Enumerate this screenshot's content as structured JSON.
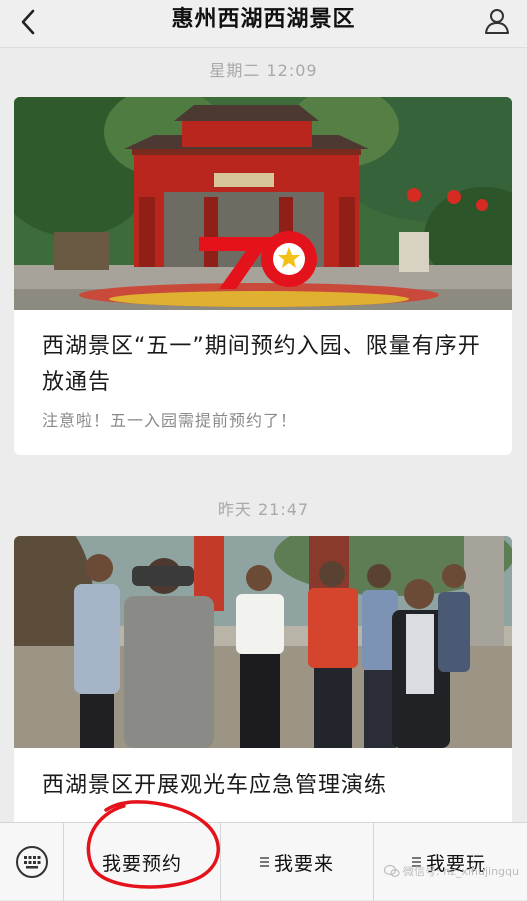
{
  "header": {
    "title": "惠州西湖西湖景区"
  },
  "feed": [
    {
      "time": "星期二 12:09",
      "title": "西湖景区“五一”期间预约入园、限量有序开放通告",
      "digest": "注意啦！五一入园需提前预约了！"
    },
    {
      "time": "昨天 21:47",
      "title": "西湖景区开展观光车应急管理演练"
    }
  ],
  "menu": {
    "items": [
      "我要预约",
      "我要来",
      "我要玩"
    ],
    "highlight_color": "#e4121b"
  },
  "watermark": "微信号: hz_xihujingqu",
  "colors": {
    "sign_red": "#e4121b",
    "gate_red": "#b8261d"
  }
}
